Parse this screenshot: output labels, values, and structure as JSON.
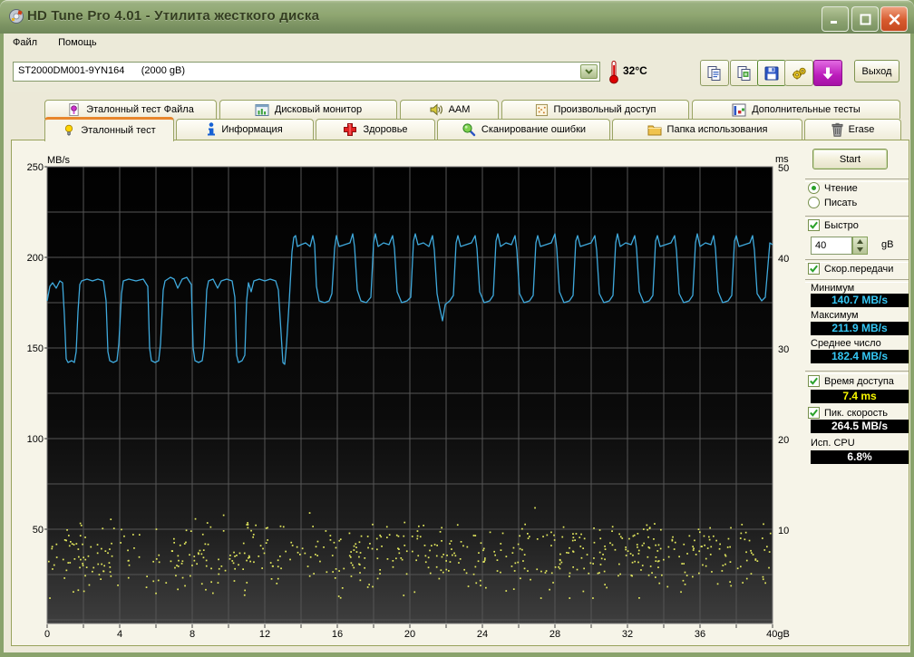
{
  "window": {
    "title": "HD Tune Pro 4.01 - Утилита жесткого диска",
    "app_icon": "hd-tune-icon",
    "controls": [
      "minimize",
      "maximize",
      "close"
    ]
  },
  "menu": {
    "items": [
      "Файл",
      "Помощь"
    ]
  },
  "toolbar": {
    "drive": "ST2000DM001-9YN164      (2000 gB)",
    "temperature": "32°C",
    "buttons": [
      {
        "icon": "copy-text-icon"
      },
      {
        "icon": "copy-image-icon"
      },
      {
        "icon": "save-icon"
      },
      {
        "icon": "options-icon"
      },
      {
        "icon": "update-icon"
      }
    ],
    "exit_label": "Выход"
  },
  "tabs": {
    "row1": [
      {
        "label": "Эталонный тест Файла",
        "icon": "file-benchmark-icon"
      },
      {
        "label": "Дисковый монитор",
        "icon": "disk-monitor-icon"
      },
      {
        "label": "AAM",
        "icon": "speaker-icon"
      },
      {
        "label": "Произвольный доступ",
        "icon": "random-access-icon"
      },
      {
        "label": "Дополнительные тесты",
        "icon": "extra-tests-icon"
      }
    ],
    "row2": [
      {
        "label": "Эталонный тест",
        "icon": "benchmark-icon",
        "active": true
      },
      {
        "label": "Информация",
        "icon": "info-icon"
      },
      {
        "label": "Здоровье",
        "icon": "health-icon"
      },
      {
        "label": "Сканирование ошибки",
        "icon": "error-scan-icon"
      },
      {
        "label": "Папка использования",
        "icon": "folder-usage-icon"
      },
      {
        "label": "Erase",
        "icon": "erase-icon"
      }
    ]
  },
  "panel": {
    "start_label": "Start",
    "mode": {
      "read": "Чтение",
      "write": "Писать",
      "selected": "read"
    },
    "quick": {
      "label": "Быстро",
      "checked": true,
      "value": "40",
      "unit": "gB"
    },
    "transfer": {
      "label": "Скор.передачи",
      "checked": true,
      "min_label": "Минимум",
      "min_value": "140.7 MB/s",
      "max_label": "Максимум",
      "max_value": "211.9 MB/s",
      "avg_label": "Среднее число",
      "avg_value": "182.4 MB/s"
    },
    "access": {
      "label": "Время доступа",
      "checked": true,
      "value": "7.4 ms"
    },
    "burst": {
      "label": "Пик. скорость",
      "checked": true,
      "value": "264.5 MB/s"
    },
    "cpu": {
      "label": "Исп. CPU",
      "value": "6.8%"
    }
  },
  "chart_data": {
    "type": "line",
    "title": "HD Tune read benchmark",
    "x_axis": {
      "min": 0,
      "max": 40,
      "gridline_step": 2,
      "tick_values": [
        0,
        4,
        8,
        12,
        16,
        20,
        24,
        28,
        32,
        36,
        40
      ],
      "tick_labels": [
        "0",
        "4",
        "8",
        "12",
        "16",
        "20",
        "24",
        "28",
        "32",
        "36",
        "40gB"
      ]
    },
    "y_left": {
      "label": "MB/s",
      "min": 0,
      "max": 250,
      "gridline_step": 25,
      "tick_labels": [
        "250",
        "200",
        "150",
        "100",
        "50"
      ]
    },
    "y_right": {
      "label": "ms",
      "min": 0,
      "max": 50,
      "tick_labels": [
        "50",
        "40",
        "30",
        "20",
        "10"
      ]
    },
    "plot_bg_top": "#010101",
    "plot_bg_bottom": "#3e3e3e",
    "grid_color": "#555555",
    "border_color": "#7d7d7d",
    "series": [
      {
        "name": "transfer_rate",
        "type": "line",
        "unit": "MB/s",
        "color": "#3fa9dc",
        "points": [
          [
            0,
            176
          ],
          [
            0.15,
            184
          ],
          [
            0.3,
            186
          ],
          [
            0.5,
            183
          ],
          [
            0.7,
            187
          ],
          [
            0.85,
            186
          ],
          [
            0.95,
            168
          ],
          [
            1.05,
            144
          ],
          [
            1.15,
            142
          ],
          [
            1.35,
            143
          ],
          [
            1.5,
            142
          ],
          [
            1.6,
            148
          ],
          [
            1.7,
            170
          ],
          [
            1.8,
            185
          ],
          [
            1.9,
            187
          ],
          [
            2.2,
            188
          ],
          [
            2.5,
            187
          ],
          [
            2.8,
            188
          ],
          [
            3.1,
            187
          ],
          [
            3.25,
            176
          ],
          [
            3.35,
            148
          ],
          [
            3.45,
            143
          ],
          [
            3.65,
            142
          ],
          [
            3.85,
            143
          ],
          [
            3.95,
            152
          ],
          [
            4.1,
            180
          ],
          [
            4.2,
            187
          ],
          [
            4.5,
            188
          ],
          [
            4.9,
            187
          ],
          [
            5.3,
            188
          ],
          [
            5.55,
            184
          ],
          [
            5.65,
            150
          ],
          [
            5.75,
            143
          ],
          [
            5.95,
            142
          ],
          [
            6.15,
            143
          ],
          [
            6.25,
            152
          ],
          [
            6.4,
            182
          ],
          [
            6.5,
            187
          ],
          [
            6.8,
            189
          ],
          [
            7.0,
            188
          ],
          [
            7.2,
            183
          ],
          [
            7.45,
            188
          ],
          [
            7.7,
            189
          ],
          [
            7.95,
            185
          ],
          [
            8.05,
            150
          ],
          [
            8.15,
            143
          ],
          [
            8.35,
            142
          ],
          [
            8.55,
            143
          ],
          [
            8.65,
            150
          ],
          [
            8.8,
            182
          ],
          [
            8.9,
            187
          ],
          [
            9.15,
            188
          ],
          [
            9.4,
            183
          ],
          [
            9.6,
            187
          ],
          [
            9.9,
            188
          ],
          [
            10.2,
            187
          ],
          [
            10.35,
            178
          ],
          [
            10.45,
            146
          ],
          [
            10.55,
            142
          ],
          [
            10.75,
            143
          ],
          [
            10.9,
            146
          ],
          [
            11.0,
            176
          ],
          [
            11.1,
            186
          ],
          [
            11.25,
            181
          ],
          [
            11.4,
            187
          ],
          [
            11.7,
            188
          ],
          [
            12.0,
            187
          ],
          [
            12.3,
            188
          ],
          [
            12.6,
            187
          ],
          [
            12.75,
            182
          ],
          [
            12.9,
            158
          ],
          [
            13.0,
            142
          ],
          [
            13.1,
            141
          ],
          [
            13.2,
            152
          ],
          [
            13.35,
            176
          ],
          [
            13.5,
            203
          ],
          [
            13.6,
            211
          ],
          [
            13.7,
            212
          ],
          [
            13.8,
            206
          ],
          [
            14.0,
            207
          ],
          [
            14.25,
            208
          ],
          [
            14.5,
            206
          ],
          [
            14.65,
            212
          ],
          [
            14.75,
            207
          ],
          [
            14.85,
            184
          ],
          [
            15.0,
            176
          ],
          [
            15.3,
            175
          ],
          [
            15.55,
            176
          ],
          [
            15.7,
            180
          ],
          [
            15.85,
            205
          ],
          [
            15.95,
            212
          ],
          [
            16.1,
            206
          ],
          [
            16.4,
            207
          ],
          [
            16.7,
            208
          ],
          [
            16.85,
            213
          ],
          [
            16.95,
            206
          ],
          [
            17.1,
            182
          ],
          [
            17.3,
            176
          ],
          [
            17.6,
            175
          ],
          [
            17.85,
            178
          ],
          [
            18.0,
            208
          ],
          [
            18.1,
            213
          ],
          [
            18.25,
            206
          ],
          [
            18.55,
            208
          ],
          [
            18.85,
            207
          ],
          [
            19.05,
            212
          ],
          [
            19.15,
            205
          ],
          [
            19.3,
            181
          ],
          [
            19.55,
            175
          ],
          [
            19.85,
            176
          ],
          [
            20.05,
            178
          ],
          [
            20.2,
            209
          ],
          [
            20.3,
            213
          ],
          [
            20.45,
            207
          ],
          [
            20.75,
            208
          ],
          [
            21.05,
            206
          ],
          [
            21.25,
            212
          ],
          [
            21.35,
            204
          ],
          [
            21.5,
            180
          ],
          [
            21.65,
            172
          ],
          [
            21.8,
            165
          ],
          [
            21.95,
            174
          ],
          [
            22.2,
            176
          ],
          [
            22.4,
            179
          ],
          [
            22.55,
            208
          ],
          [
            22.65,
            212
          ],
          [
            22.8,
            206
          ],
          [
            23.1,
            207
          ],
          [
            23.4,
            208
          ],
          [
            23.6,
            212
          ],
          [
            23.7,
            205
          ],
          [
            23.85,
            181
          ],
          [
            24.1,
            175
          ],
          [
            24.4,
            176
          ],
          [
            24.6,
            179
          ],
          [
            24.75,
            209
          ],
          [
            24.85,
            213
          ],
          [
            25.0,
            206
          ],
          [
            25.3,
            208
          ],
          [
            25.6,
            207
          ],
          [
            25.8,
            212
          ],
          [
            25.9,
            204
          ],
          [
            26.05,
            180
          ],
          [
            26.3,
            175
          ],
          [
            26.6,
            176
          ],
          [
            26.8,
            179
          ],
          [
            26.95,
            208
          ],
          [
            27.05,
            212
          ],
          [
            27.2,
            206
          ],
          [
            27.5,
            207
          ],
          [
            27.8,
            208
          ],
          [
            28.0,
            213
          ],
          [
            28.1,
            205
          ],
          [
            28.25,
            181
          ],
          [
            28.5,
            175
          ],
          [
            28.8,
            176
          ],
          [
            29.0,
            179
          ],
          [
            29.15,
            209
          ],
          [
            29.25,
            212
          ],
          [
            29.4,
            206
          ],
          [
            29.7,
            207
          ],
          [
            30.0,
            208
          ],
          [
            30.2,
            212
          ],
          [
            30.3,
            204
          ],
          [
            30.45,
            180
          ],
          [
            30.7,
            175
          ],
          [
            31.0,
            176
          ],
          [
            31.2,
            179
          ],
          [
            31.35,
            208
          ],
          [
            31.45,
            213
          ],
          [
            31.6,
            206
          ],
          [
            31.9,
            208
          ],
          [
            32.2,
            207
          ],
          [
            32.4,
            212
          ],
          [
            32.5,
            205
          ],
          [
            32.65,
            181
          ],
          [
            32.9,
            175
          ],
          [
            33.2,
            176
          ],
          [
            33.4,
            179
          ],
          [
            33.55,
            209
          ],
          [
            33.65,
            212
          ],
          [
            33.8,
            206
          ],
          [
            34.1,
            207
          ],
          [
            34.4,
            208
          ],
          [
            34.6,
            212
          ],
          [
            34.7,
            204
          ],
          [
            34.85,
            180
          ],
          [
            35.1,
            175
          ],
          [
            35.4,
            176
          ],
          [
            35.6,
            179
          ],
          [
            35.75,
            208
          ],
          [
            35.85,
            213
          ],
          [
            36.0,
            206
          ],
          [
            36.3,
            208
          ],
          [
            36.6,
            207
          ],
          [
            36.75,
            212
          ],
          [
            36.85,
            205
          ],
          [
            37.0,
            181
          ],
          [
            37.25,
            175
          ],
          [
            37.55,
            176
          ],
          [
            37.75,
            179
          ],
          [
            37.9,
            209
          ],
          [
            38.0,
            212
          ],
          [
            38.15,
            206
          ],
          [
            38.45,
            207
          ],
          [
            38.75,
            208
          ],
          [
            38.9,
            212
          ],
          [
            39.0,
            204
          ],
          [
            39.15,
            180
          ],
          [
            39.4,
            176
          ],
          [
            39.6,
            178
          ],
          [
            39.75,
            196
          ],
          [
            39.85,
            208
          ],
          [
            40,
            207
          ]
        ]
      },
      {
        "name": "access_time",
        "type": "scatter",
        "unit": "ms",
        "color": "#e4e95e",
        "generated": {
          "seed": 20,
          "count": 620,
          "x_min": 0,
          "x_max": 40,
          "ms_mean": 7.2,
          "ms_spread": 3.3,
          "ms_min": 2.4,
          "ms_max": 14.6,
          "measured_average_ms": 7.4
        }
      }
    ]
  }
}
